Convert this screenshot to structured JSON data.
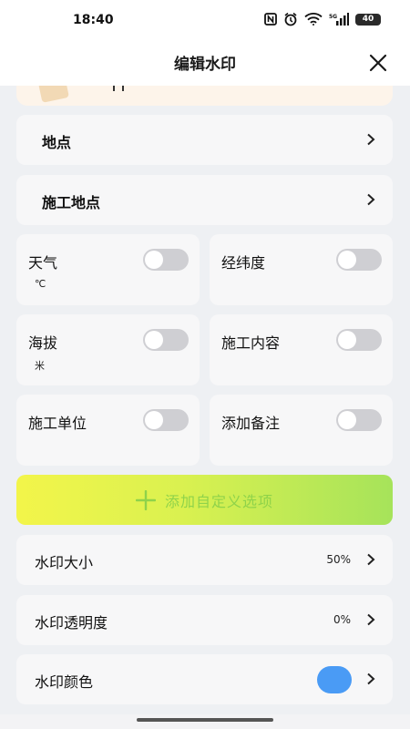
{
  "status_bar": {
    "time": "18:40",
    "battery": "40",
    "network": "5G"
  },
  "header": {
    "title": "编辑水印"
  },
  "rows": {
    "location": {
      "label": "地点"
    },
    "site": {
      "label": "施工地点"
    }
  },
  "toggles": {
    "weather": {
      "label": "天气",
      "sub": "℃",
      "on": false
    },
    "latlng": {
      "label": "经纬度",
      "on": false
    },
    "altitude": {
      "label": "海拔",
      "sub": "米",
      "on": false
    },
    "content": {
      "label": "施工内容",
      "on": false
    },
    "unit": {
      "label": "施工单位",
      "on": false
    },
    "note": {
      "label": "添加备注",
      "on": false
    }
  },
  "add_custom": {
    "label": "添加自定义选项"
  },
  "settings": {
    "size": {
      "label": "水印大小",
      "value": "50%"
    },
    "opacity": {
      "label": "水印透明度",
      "value": "0%"
    },
    "color": {
      "label": "水印颜色",
      "value_color": "#4a9bf5"
    }
  },
  "colors": {
    "accent": "#a6e35a",
    "switch_off": "#cfcfd3",
    "watermark_color": "#4a9bf5"
  }
}
